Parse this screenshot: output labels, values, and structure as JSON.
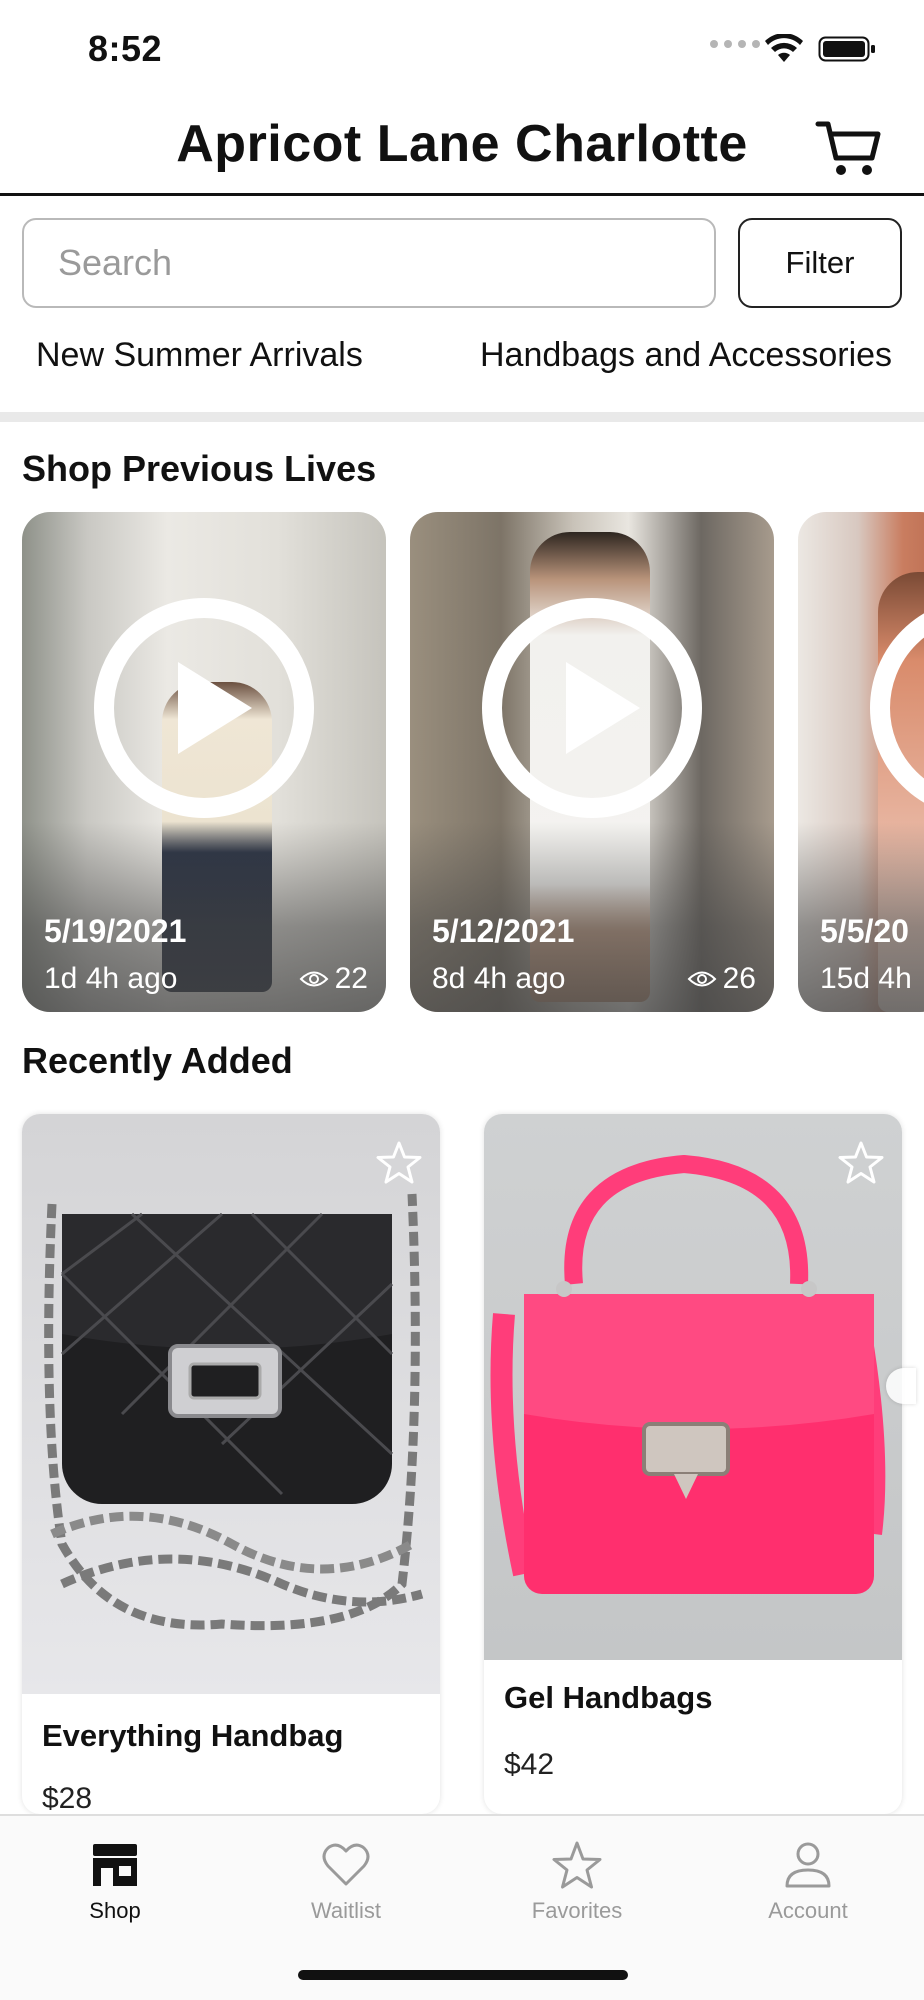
{
  "status_bar": {
    "time": "8:52"
  },
  "header": {
    "title": "Apricot Lane Charlotte",
    "cart_icon": "cart-icon"
  },
  "search": {
    "placeholder": "Search",
    "value": "",
    "filter_label": "Filter"
  },
  "categories": [
    "New Summer Arrivals",
    "Handbags and Accessories"
  ],
  "sections": {
    "previous_lives": "Shop Previous Lives",
    "recently_added": "Recently Added"
  },
  "lives": [
    {
      "date": "5/19/2021",
      "ago": "1d 4h ago",
      "views": "22"
    },
    {
      "date": "5/12/2021",
      "ago": "8d 4h ago",
      "views": "26"
    },
    {
      "date": "5/5/20",
      "ago": "15d 4h"
    }
  ],
  "products": [
    {
      "name": "Everything Handbag",
      "price": "$28"
    },
    {
      "name": "Gel Handbags",
      "price": "$42"
    }
  ],
  "tab_bar": [
    {
      "label": "Shop",
      "icon": "store-icon",
      "active": true
    },
    {
      "label": "Waitlist",
      "icon": "heart-icon",
      "active": false
    },
    {
      "label": "Favorites",
      "icon": "star-icon",
      "active": false
    },
    {
      "label": "Account",
      "icon": "person-icon",
      "active": false
    }
  ],
  "colors": {
    "accent": "#111111",
    "inactive": "#9a9a9a",
    "divider": "#e9e9e9",
    "gel_bag": "#ff2f6e"
  }
}
